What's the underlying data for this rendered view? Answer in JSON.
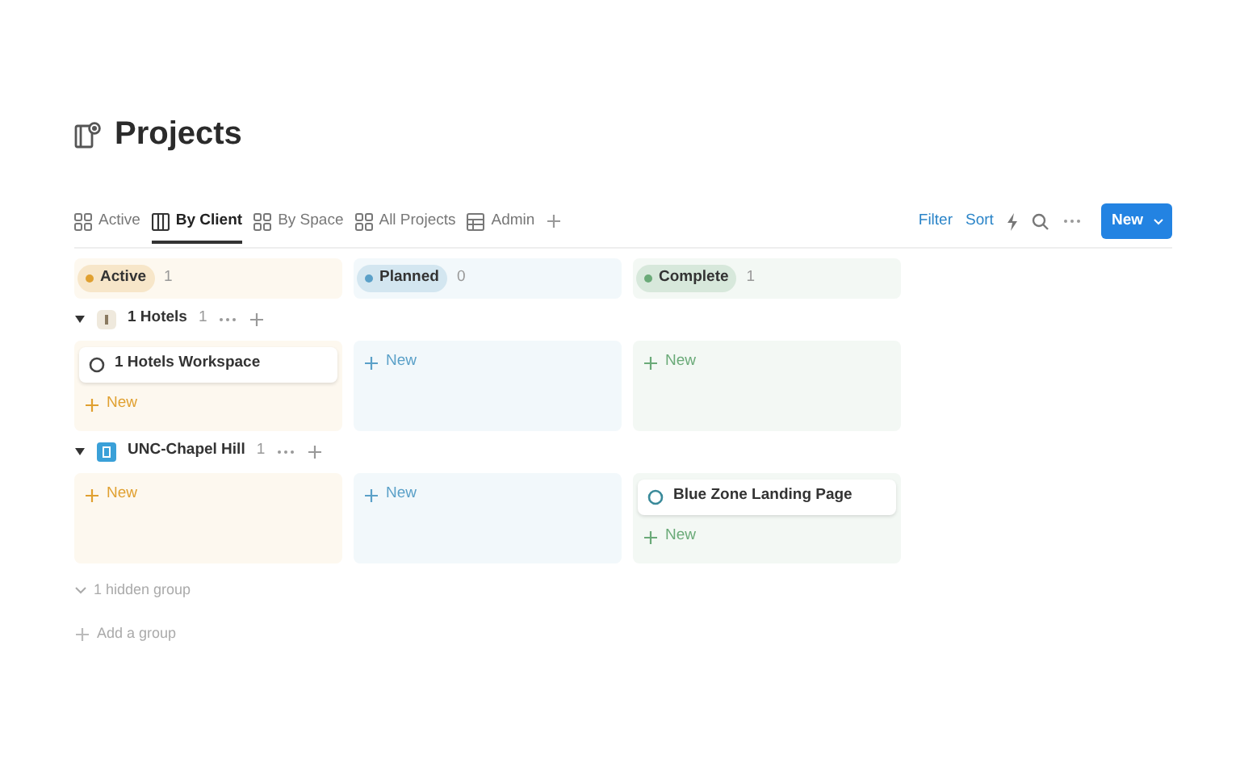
{
  "title": "Projects",
  "tabs": [
    {
      "label": "Active",
      "kind": "gallery",
      "selected": false
    },
    {
      "label": "By Client",
      "kind": "board",
      "selected": true
    },
    {
      "label": "By Space",
      "kind": "gallery",
      "selected": false
    },
    {
      "label": "All Projects",
      "kind": "gallery",
      "selected": false
    },
    {
      "label": "Admin",
      "kind": "table",
      "selected": false
    }
  ],
  "toolbar": {
    "filter": "Filter",
    "sort": "Sort",
    "new_button": "New"
  },
  "columns": [
    {
      "label": "Active",
      "count": "1",
      "color": "#e0a030"
    },
    {
      "label": "Planned",
      "count": "0",
      "color": "#5aa0c8"
    },
    {
      "label": "Complete",
      "count": "1",
      "color": "#6aaa78"
    }
  ],
  "groups": [
    {
      "name": "1 Hotels",
      "count": "1",
      "expanded": true,
      "cells": [
        {
          "cards": [
            "1 Hotels Workspace"
          ],
          "new_label": "New"
        },
        {
          "new_label": "New"
        },
        {
          "new_label": "New"
        }
      ]
    },
    {
      "name": "UNC-Chapel Hill",
      "count": "1",
      "expanded": true,
      "cells": [
        {
          "new_label": "New"
        },
        {
          "new_label": "New"
        },
        {
          "cards": [
            "Blue Zone Landing Page"
          ],
          "new_label": "New"
        }
      ]
    }
  ],
  "hidden_groups": "1 hidden group",
  "add_group": "Add a group"
}
